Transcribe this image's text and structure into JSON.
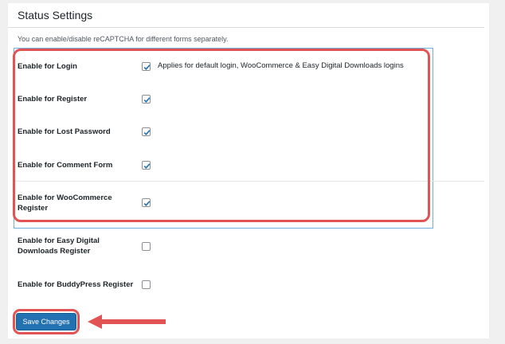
{
  "section": {
    "title": "Status Settings",
    "description": "You can enable/disable reCAPTCHA for different forms separately."
  },
  "rows": [
    {
      "label": "Enable for Login",
      "checked": true,
      "note": "Applies for default login, WooCommerce & Easy Digital Downloads logins"
    },
    {
      "label": "Enable for Register",
      "checked": true
    },
    {
      "label": "Enable for Lost Password",
      "checked": true
    },
    {
      "label": "Enable for Comment Form",
      "checked": true
    },
    {
      "label": "Enable for WooCommerce Register",
      "checked": true
    },
    {
      "label": "Enable for Easy Digital Downloads Register",
      "checked": false
    },
    {
      "label": "Enable for BuddyPress Register",
      "checked": false
    }
  ],
  "actions": {
    "save_label": "Save Changes"
  },
  "colors": {
    "primary_button": "#2271b1",
    "annotation_red": "#e25454",
    "checkmark": "#2271b1"
  }
}
